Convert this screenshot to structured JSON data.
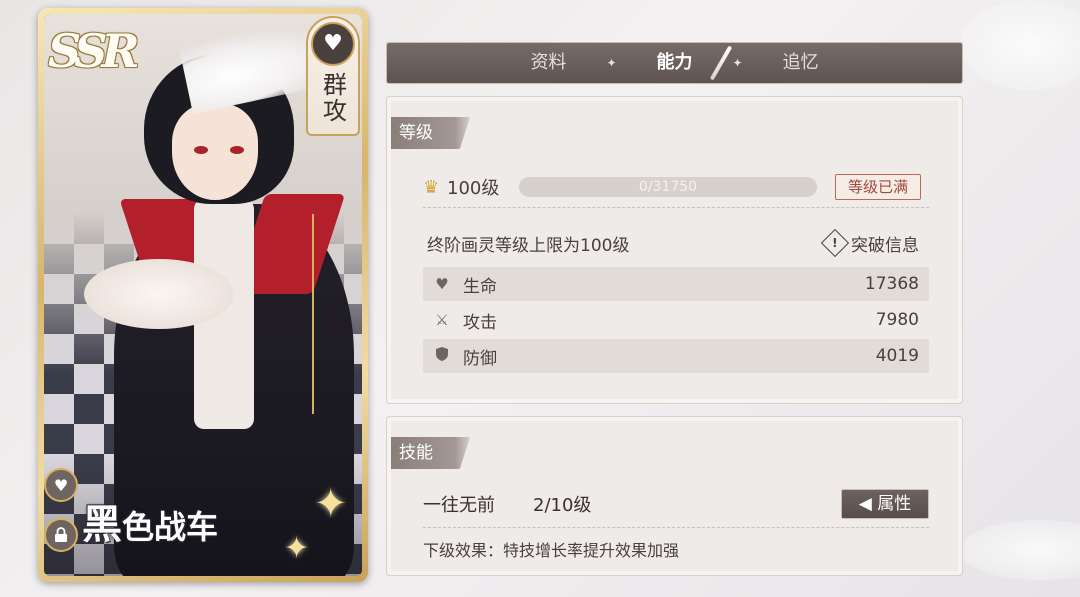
{
  "card": {
    "rarity": "SSR",
    "class_label": "群攻",
    "name_first": "黑",
    "name_rest": "色战车",
    "icons": [
      "heart-icon",
      "lock-icon",
      "heart-pulse-icon"
    ]
  },
  "tabs": {
    "items": [
      {
        "label": "资料",
        "active": false
      },
      {
        "label": "能力",
        "active": true
      },
      {
        "label": "追忆",
        "active": false
      }
    ],
    "separator": "✦"
  },
  "level_section": {
    "title": "等级",
    "level_label": "100级",
    "exp_text": "0/31750",
    "exp_progress": 0,
    "max_badge": "等级已满",
    "cap_text": "终阶画灵等级上限为100级",
    "breakthrough_label": "突破信息",
    "stats": [
      {
        "icon": "heart-icon",
        "label": "生命",
        "value": "17368"
      },
      {
        "icon": "swords-icon",
        "label": "攻击",
        "value": "7980"
      },
      {
        "icon": "shield-icon",
        "label": "防御",
        "value": "4019"
      }
    ]
  },
  "skill_section": {
    "title": "技能",
    "skill_name": "一往无前",
    "skill_level": "2/10级",
    "attr_button": "属性",
    "effect_text": "下级效果：特技增长率提升效果加强"
  },
  "colors": {
    "accent_gold": "#d8b15c",
    "tab_bg": "#6a5f5b",
    "panel_bg": "#efebe8",
    "max_badge_red": "#a34a3c"
  }
}
